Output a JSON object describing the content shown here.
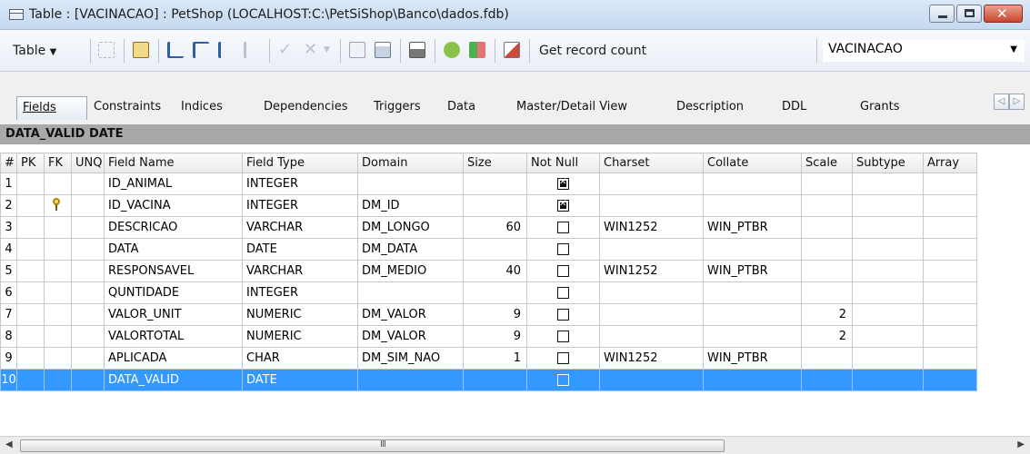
{
  "window": {
    "title": "Table : [VACINACAO] : PetShop (LOCALHOST:C:\\PetSiShop\\Banco\\dados.fdb)"
  },
  "toolbar": {
    "table_menu_label": "Table",
    "get_record_count_label": "Get record count",
    "table_selector_value": "VACINACAO"
  },
  "tabs": [
    {
      "label": "Fields"
    },
    {
      "label": "Constraints"
    },
    {
      "label": "Indices"
    },
    {
      "label": "Dependencies"
    },
    {
      "label": "Triggers"
    },
    {
      "label": "Data"
    },
    {
      "label": "Master/Detail View"
    },
    {
      "label": "Description"
    },
    {
      "label": "DDL"
    },
    {
      "label": "Grants"
    }
  ],
  "field_header": "DATA_VALID DATE",
  "grid": {
    "columns": [
      "#",
      "PK",
      "FK",
      "UNQ",
      "Field Name",
      "Field Type",
      "Domain",
      "Size",
      "Not Null",
      "Charset",
      "Collate",
      "Scale",
      "Subtype",
      "Array"
    ],
    "rows": [
      {
        "num": "1",
        "fk": false,
        "name": "ID_ANIMAL",
        "type": "INTEGER",
        "domain": "",
        "size": "",
        "not_null": true,
        "charset": "",
        "collate": "",
        "scale": "",
        "subtype": "",
        "array": ""
      },
      {
        "num": "2",
        "fk": true,
        "name": "ID_VACINA",
        "type": "INTEGER",
        "domain": "DM_ID",
        "size": "",
        "not_null": true,
        "charset": "",
        "collate": "",
        "scale": "",
        "subtype": "",
        "array": ""
      },
      {
        "num": "3",
        "fk": false,
        "name": "DESCRICAO",
        "type": "VARCHAR",
        "domain": "DM_LONGO",
        "size": "60",
        "not_null": false,
        "charset": "WIN1252",
        "collate": "WIN_PTBR",
        "scale": "",
        "subtype": "",
        "array": ""
      },
      {
        "num": "4",
        "fk": false,
        "name": "DATA",
        "type": "DATE",
        "domain": "DM_DATA",
        "size": "",
        "not_null": false,
        "charset": "",
        "collate": "",
        "scale": "",
        "subtype": "",
        "array": ""
      },
      {
        "num": "5",
        "fk": false,
        "name": "RESPONSAVEL",
        "type": "VARCHAR",
        "domain": "DM_MEDIO",
        "size": "40",
        "not_null": false,
        "charset": "WIN1252",
        "collate": "WIN_PTBR",
        "scale": "",
        "subtype": "",
        "array": ""
      },
      {
        "num": "6",
        "fk": false,
        "name": "QUNTIDADE",
        "type": "INTEGER",
        "domain": "",
        "size": "",
        "not_null": false,
        "charset": "",
        "collate": "",
        "scale": "",
        "subtype": "",
        "array": ""
      },
      {
        "num": "7",
        "fk": false,
        "name": "VALOR_UNIT",
        "type": "NUMERIC",
        "domain": "DM_VALOR",
        "size": "9",
        "not_null": false,
        "charset": "",
        "collate": "",
        "scale": "2",
        "subtype": "",
        "array": ""
      },
      {
        "num": "8",
        "fk": false,
        "name": "VALORTOTAL",
        "type": "NUMERIC",
        "domain": "DM_VALOR",
        "size": "9",
        "not_null": false,
        "charset": "",
        "collate": "",
        "scale": "2",
        "subtype": "",
        "array": ""
      },
      {
        "num": "9",
        "fk": false,
        "name": "APLICADA",
        "type": "CHAR",
        "domain": "DM_SIM_NAO",
        "size": "1",
        "not_null": false,
        "charset": "WIN1252",
        "collate": "WIN_PTBR",
        "scale": "",
        "subtype": "",
        "array": ""
      },
      {
        "num": "10",
        "fk": false,
        "name": "DATA_VALID",
        "type": "DATE",
        "domain": "",
        "size": "",
        "not_null": false,
        "charset": "",
        "collate": "",
        "scale": "",
        "subtype": "",
        "array": "",
        "selected": true
      }
    ]
  },
  "icons": {
    "app": "table-icon",
    "fk": "foreign-key-icon"
  },
  "colors": {
    "selection": "#3399ff",
    "header_band": "#a9a9a9",
    "close_button": "#c8462f"
  }
}
